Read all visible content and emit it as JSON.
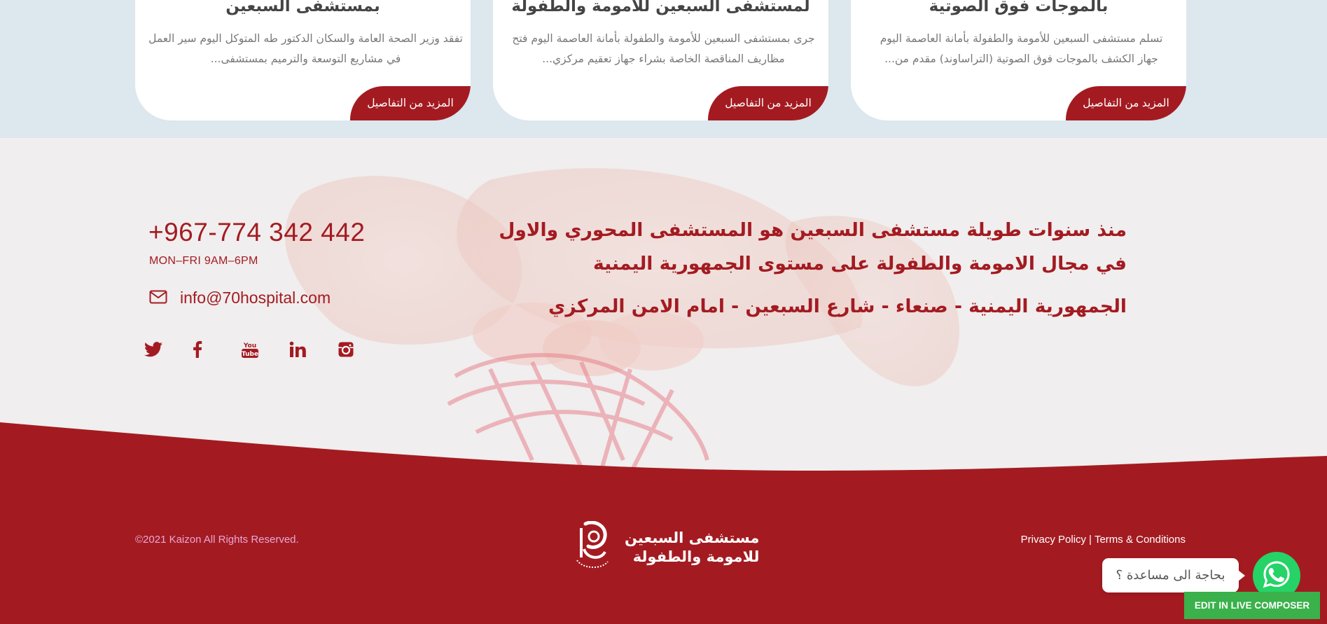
{
  "news_cards": [
    {
      "title": "بمستشفى السبعين",
      "excerpt_line1": "تفقد وزير الصحة العامة والسكان الدكتور طه المتوكل اليوم سير العمل",
      "excerpt_line2": "في مشاريع التوسعة والترميم بمستشفى...",
      "button": "المزيد من التفاصيل"
    },
    {
      "title": "لمستشفى السبعين للامومة والطفولة",
      "excerpt_line1": "جرى بمستشفى السبعين للأمومة والطفولة بأمانة العاصمة اليوم فتح",
      "excerpt_line2": "مظاريف المناقصة الخاصة بشراء جهاز تعقيم مركزي...",
      "button": "المزيد من التفاصيل"
    },
    {
      "title": "بالموجات فوق الصوتية",
      "excerpt_line1": "تسلم مستشفى السبعين للأمومة والطفولة بأمانة العاصمة اليوم",
      "excerpt_line2": "جهاز الكشف بالموجات فوق الصوتية (التراساوند) مقدم من...",
      "button": "المزيد من التفاصيل"
    }
  ],
  "contact": {
    "phone": "+967-774 342 442",
    "hours": "MON–FRI 9AM–6PM",
    "email": "info@70hospital.com",
    "socials": [
      {
        "icon": "twitter-icon"
      },
      {
        "icon": "facebook-icon"
      },
      {
        "icon": "youtube-icon"
      },
      {
        "icon": "linkedin-icon"
      },
      {
        "icon": "instagram-icon"
      }
    ]
  },
  "about": {
    "line1": "منذ سنوات طويلة مستشفى السبعين هو المستشفى المحوري والاول",
    "line2": "في مجال الامومة والطفولة على مستوى الجمهورية اليمنية",
    "address": "الجمهورية اليمنية - صنعاء - شارع السبعين - امام الامن المركزي"
  },
  "footer": {
    "copyright": "©2021 Kaizon All Rights Reserved.",
    "logo_line1": "مستشفى السبعين",
    "logo_line2": "للامومة والطفولة",
    "privacy": "Privacy Policy",
    "separator": "|",
    "terms": "Terms & Conditions"
  },
  "chat": {
    "prompt": "بحاجة الى مساعدة ؟",
    "edit_button": "EDIT IN LIVE COMPOSER"
  },
  "colors": {
    "brand_red": "#a31b21",
    "strip_bg": "#dce7ee",
    "whatsapp_green": "#25d366",
    "composer_green": "#3ab14a"
  }
}
